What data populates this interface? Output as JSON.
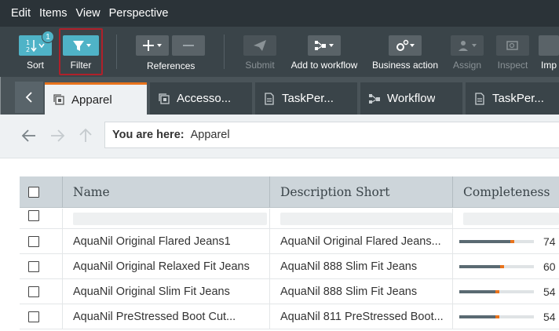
{
  "menu": [
    "Edit",
    "Items",
    "View",
    "Perspective"
  ],
  "toolbar": {
    "sort": {
      "label": "Sort",
      "badge": "1"
    },
    "filter": {
      "label": "Filter"
    },
    "references": {
      "label": "References"
    },
    "submit": {
      "label": "Submit"
    },
    "add_to_workflow": {
      "label": "Add to workflow"
    },
    "business_action": {
      "label": "Business action"
    },
    "assign": {
      "label": "Assign"
    },
    "inspect": {
      "label": "Inspect"
    },
    "import": {
      "label": "Imp"
    }
  },
  "tabs": [
    {
      "label": "Apparel",
      "icon": "collection-icon",
      "active": true
    },
    {
      "label": "Accesso...",
      "icon": "collection-icon",
      "active": false
    },
    {
      "label": "TaskPer...",
      "icon": "document-icon",
      "active": false
    },
    {
      "label": "Workflow",
      "icon": "workflow-icon",
      "active": false
    },
    {
      "label": "TaskPer...",
      "icon": "document-icon",
      "active": false
    }
  ],
  "breadcrumb": {
    "prefix": "You are here:",
    "path": "Apparel"
  },
  "grid": {
    "columns": [
      "Name",
      "Description Short",
      "Completeness"
    ],
    "rows": [
      {
        "name": "AquaNil Original Flared Jeans1",
        "description": "AquaNil Original Flared Jeans...",
        "completeness": 74,
        "completeness_label": "74"
      },
      {
        "name": "AquaNil Original Relaxed Fit Jeans",
        "description": "AquaNil 888 Slim Fit Jeans",
        "completeness": 60,
        "completeness_label": "60"
      },
      {
        "name": "AquaNil Original Slim Fit Jeans",
        "description": "AquaNil 888 Slim Fit Jeans",
        "completeness": 54,
        "completeness_label": "54"
      },
      {
        "name": "AquaNil PreStressed Boot Cut...",
        "description": "AquaNil 811 PreStressed Boot...",
        "completeness": 54,
        "completeness_label": "54"
      }
    ]
  },
  "colors": {
    "accent_teal": "#4fb3c7",
    "active_tab_orange": "#e8731c",
    "highlight_red": "#b0202a"
  }
}
